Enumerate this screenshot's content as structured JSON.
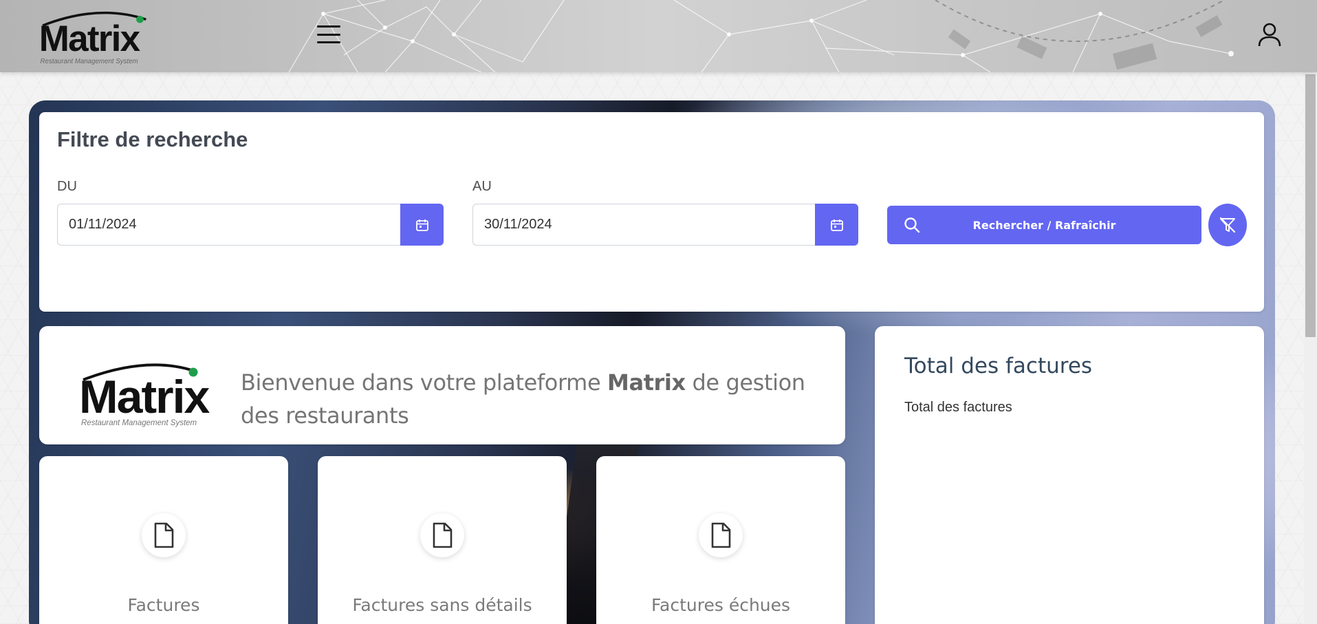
{
  "brand": {
    "name": "Matrix",
    "tagline": "Restaurant Management System",
    "accent": "#6366f1",
    "dot_color": "#1e9e4a"
  },
  "topbar": {
    "menu_icon": "hamburger-menu-icon",
    "user_icon": "user-icon"
  },
  "filter": {
    "title": "Filtre de recherche",
    "from_label": "DU",
    "from_value": "01/11/2024",
    "to_label": "AU",
    "to_value": "30/11/2024",
    "calendar_icon": "calendar-icon",
    "search_label": "Rechercher / Rafraîchir",
    "search_icon": "search-icon",
    "clear_icon": "filter-off-icon"
  },
  "welcome": {
    "prefix": "Bienvenue dans votre plateforme ",
    "brand": "Matrix",
    "suffix": " de gestion des restaurants"
  },
  "total": {
    "title": "Total des factures",
    "subtitle": "Total des factures"
  },
  "stats": [
    {
      "label": "Factures",
      "icon": "document-icon"
    },
    {
      "label": "Factures sans détails",
      "icon": "document-icon"
    },
    {
      "label": "Factures échues",
      "icon": "document-icon"
    }
  ]
}
